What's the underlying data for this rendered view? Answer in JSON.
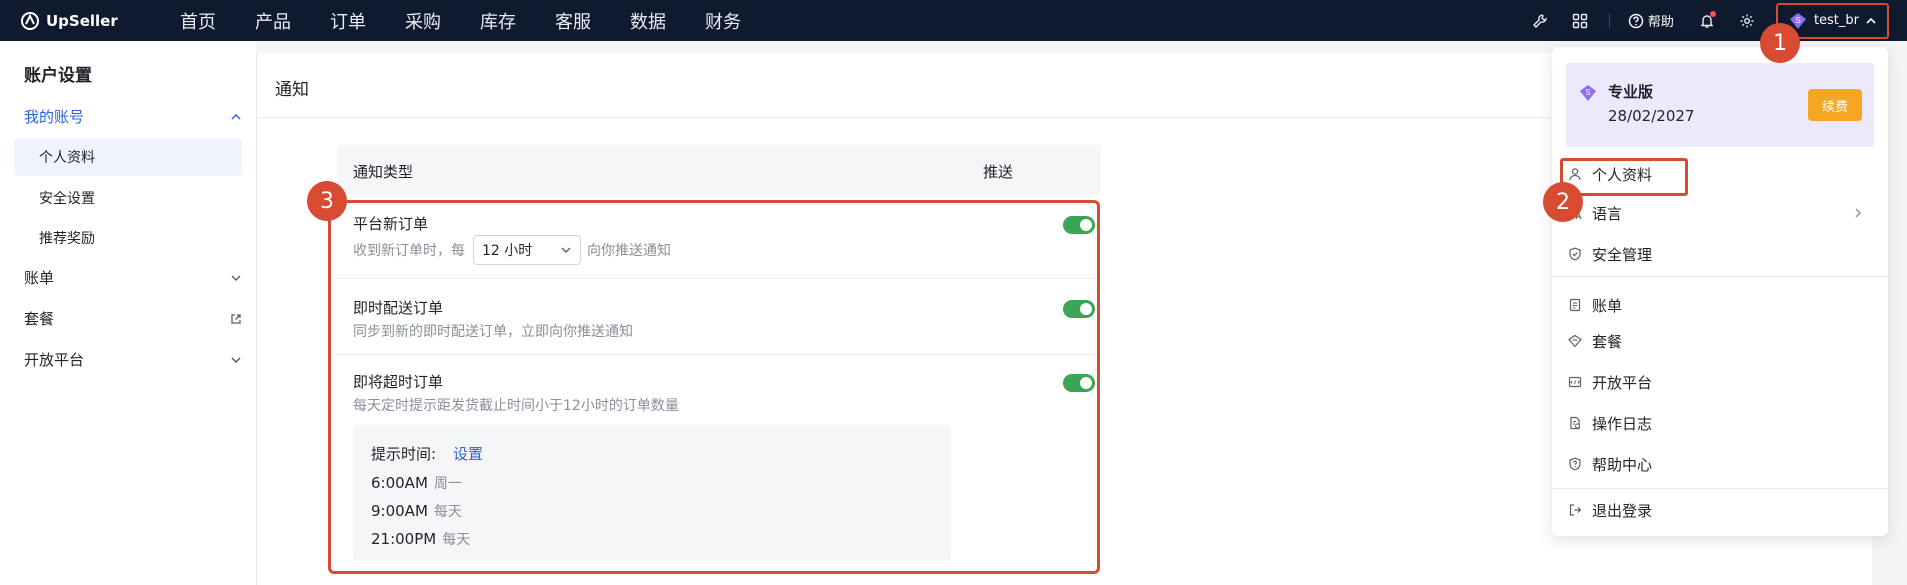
{
  "app": {
    "logo_text": "UpSeller"
  },
  "topnav": {
    "items": [
      "首页",
      "产品",
      "订单",
      "采购",
      "库存",
      "客服",
      "数据",
      "财务"
    ],
    "help_label": "帮助",
    "username": "test_br"
  },
  "sidebar": {
    "title": "账户设置",
    "my_account": "我的账号",
    "sub_items": [
      "个人资料",
      "安全设置",
      "推荐奖励"
    ],
    "items": [
      "账单",
      "套餐",
      "开放平台"
    ]
  },
  "main": {
    "title": "通知",
    "table": {
      "col_type": "通知类型",
      "col_push": "推送",
      "rows": [
        {
          "title": "平台新订单",
          "desc_before": "收到新订单时，每",
          "select_value": "12 小时",
          "desc_after": "向你推送通知",
          "enabled": true
        },
        {
          "title": "即时配送订单",
          "desc": "同步到新的即时配送订单，立即向你推送通知",
          "enabled": true
        },
        {
          "title": "即将超时订单",
          "desc": "每天定时提示距发货截止时间小于12小时的订单数量",
          "enabled": true
        }
      ],
      "tip": {
        "label": "提示时间:",
        "link": "设置",
        "times": [
          {
            "time": "6:00AM",
            "when": "周一"
          },
          {
            "time": "9:00AM",
            "when": "每天"
          },
          {
            "time": "21:00PM",
            "when": "每天"
          }
        ]
      }
    }
  },
  "dropdown": {
    "plan_name": "专业版",
    "plan_date": "28/02/2027",
    "renew_label": "续费",
    "menu": {
      "profile": "个人资料",
      "language": "语言",
      "security": "安全管理",
      "billing": "账单",
      "plan": "套餐",
      "open_platform": "开放平台",
      "logs": "操作日志",
      "help_center": "帮助中心",
      "logout": "退出登录"
    }
  },
  "badges": {
    "one": "1",
    "two": "2",
    "three": "3"
  },
  "colors": {
    "nav_bg": "#0f1a2e",
    "accent_blue": "#2d63d8",
    "toggle_green": "#3aa655",
    "annotation_red": "#d84a32",
    "renew_orange": "#f5a623"
  }
}
